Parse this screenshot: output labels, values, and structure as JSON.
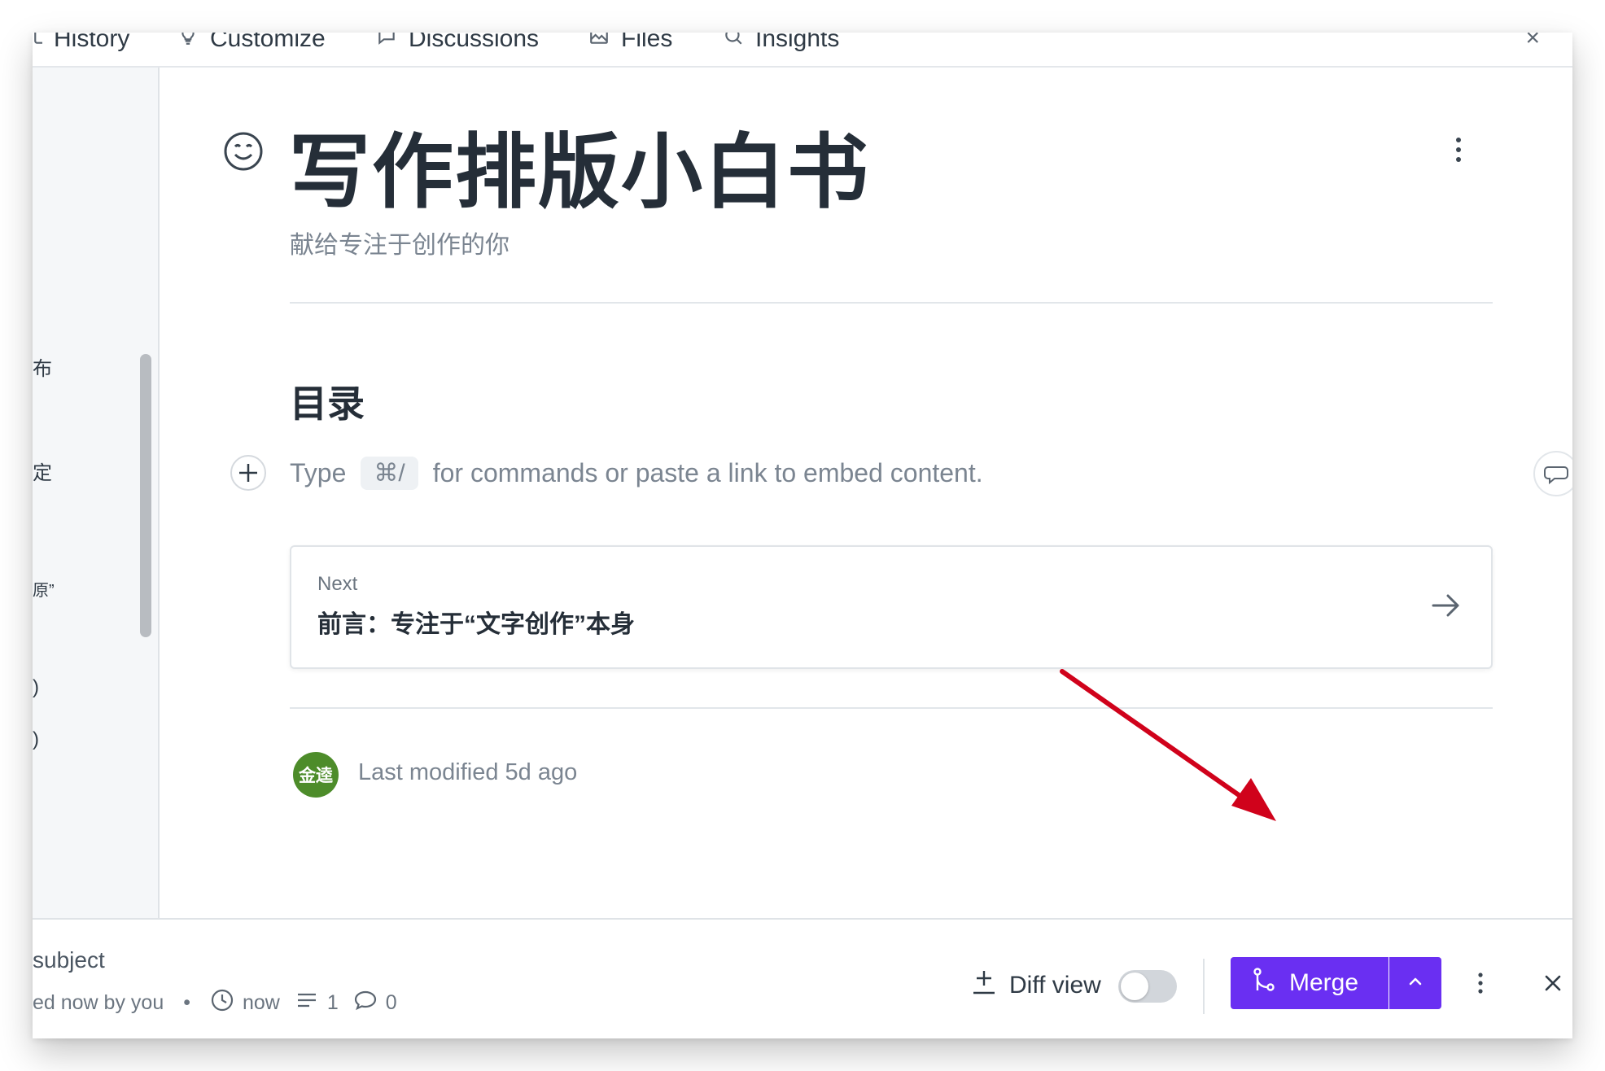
{
  "tabs": [
    {
      "label": "History",
      "icon": "history-icon"
    },
    {
      "label": "Customize",
      "icon": "bulb-icon"
    },
    {
      "label": "Discussions",
      "icon": "chat-icon"
    },
    {
      "label": "Files",
      "icon": "image-icon"
    },
    {
      "label": "Insights",
      "icon": "insights-icon"
    }
  ],
  "sidebar": {
    "items": [
      "布",
      "定",
      "原”",
      ")",
      ")"
    ]
  },
  "document": {
    "title": "写作排版小白书",
    "subtitle": "献给专注于创作的你",
    "toc_heading": "目录",
    "placeholder": {
      "prefix": "Type",
      "shortcut": "⌘/",
      "suffix": "for commands or paste a link to embed content."
    },
    "next_card": {
      "label": "Next",
      "title": "前言：专注于“文字创作”本身"
    },
    "avatar_text": "金逵",
    "last_modified": "Last modified 5d ago"
  },
  "bottom_bar": {
    "subject": "subject",
    "meta": {
      "edited": "ed now by you",
      "time": "now",
      "changes": "1",
      "comments": "0"
    },
    "diff_view_label": "Diff view",
    "diff_view_enabled": false,
    "merge_label": "Merge"
  },
  "colors": {
    "accent": "#6a2ff2",
    "annotation_arrow": "#d0021b",
    "avatar_bg": "#4d8c2a",
    "title_text": "#252e38",
    "muted_text": "#7b8591"
  }
}
